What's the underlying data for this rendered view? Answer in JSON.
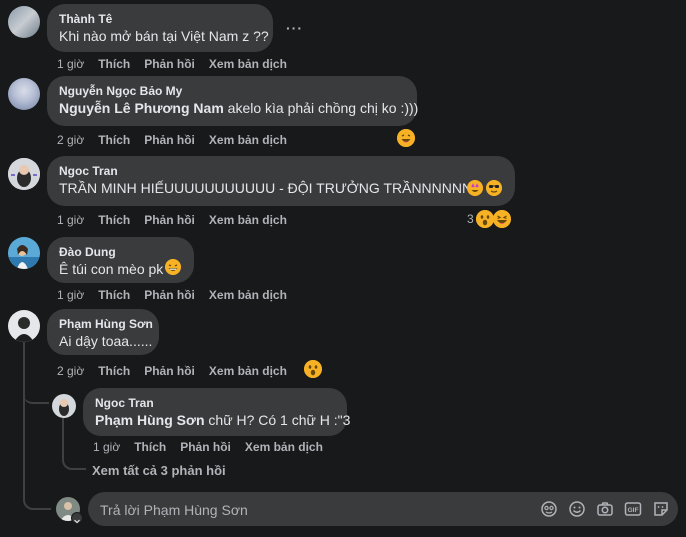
{
  "comments": [
    {
      "author": "Thành Tê",
      "text": "Khi nào mở bán tại Việt Nam z ??",
      "time": "1 giờ",
      "like": "Thích",
      "reply": "Phản hồi",
      "translate": "Xem bản dịch"
    },
    {
      "author": "Nguyễn Ngọc Bảo My",
      "mention": "Nguyễn Lê Phương Nam",
      "text": " akelo kìa phải chồng chị ko :)))",
      "time": "2 giờ",
      "like": "Thích",
      "reply": "Phản hồi",
      "translate": "Xem bản dịch",
      "reactions": [
        "laughing"
      ]
    },
    {
      "author": "Ngoc Tran",
      "text": "TRẦN MINH HIẾUUUUUUUUUUU - ĐỘI TRƯỞNG TRẦNNNNNNN",
      "time": "1 giờ",
      "like": "Thích",
      "reply": "Phản hồi",
      "translate": "Xem bản dịch",
      "reaction_count": "3",
      "reactions": [
        "wow",
        "haha"
      ]
    },
    {
      "author": "Đào Dung",
      "text": "Ê túi con mèo pk",
      "time": "1 giờ",
      "like": "Thích",
      "reply": "Phản hồi",
      "translate": "Xem bản dịch"
    },
    {
      "author": "Phạm Hùng Sơn",
      "text": "Ai dậy toaa......",
      "time": "2 giờ",
      "like": "Thích",
      "reply": "Phản hồi",
      "translate": "Xem bản dịch",
      "reactions": [
        "wow"
      ]
    }
  ],
  "reply": {
    "author": "Ngoc Tran",
    "mention": "Phạm Hùng Sơn",
    "text": " chữ H? Có 1 chữ H :\"3",
    "time": "1 giờ",
    "like": "Thích",
    "reply": "Phản hồi",
    "translate": "Xem bản dịch"
  },
  "view_replies": "Xem tất cả 3 phản hồi",
  "reply_box": {
    "placeholder": "Trả lời Phạm Hùng Sơn"
  },
  "more_options": "···",
  "colors": {
    "background": "#18191a",
    "bubble": "#3a3b3c",
    "text": "#e4e6eb",
    "secondary": "#b0b3b8",
    "reaction": "#f7b125"
  }
}
